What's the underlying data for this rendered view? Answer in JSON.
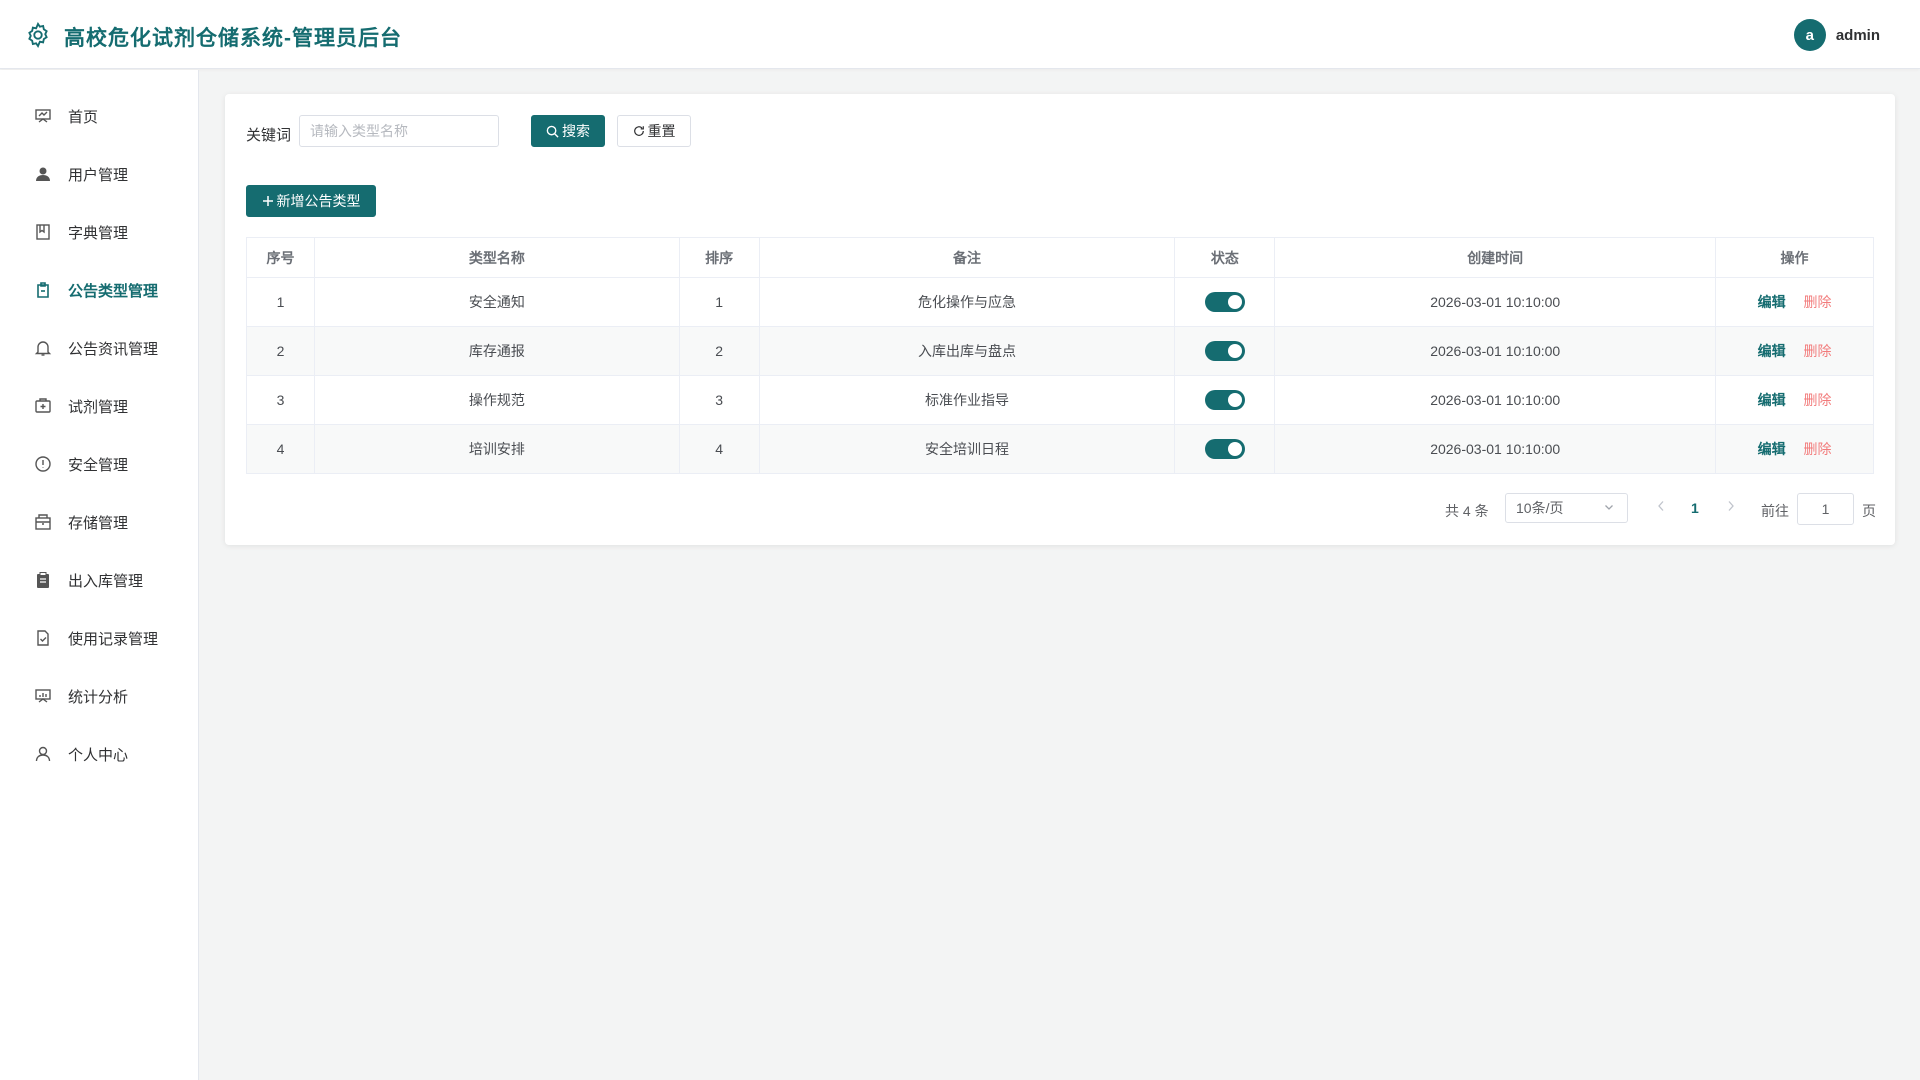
{
  "header": {
    "title": "高校危化试剂仓储系统-管理员后台",
    "avatar_letter": "a",
    "username": "admin"
  },
  "sidebar": {
    "items": [
      {
        "label": "首页",
        "icon": "dashboard-icon"
      },
      {
        "label": "用户管理",
        "icon": "user-icon"
      },
      {
        "label": "字典管理",
        "icon": "dictionary-icon"
      },
      {
        "label": "公告类型管理",
        "icon": "notice-type-icon",
        "active": true
      },
      {
        "label": "公告资讯管理",
        "icon": "bell-icon"
      },
      {
        "label": "试剂管理",
        "icon": "reagent-box-icon"
      },
      {
        "label": "安全管理",
        "icon": "warning-circle-icon"
      },
      {
        "label": "存储管理",
        "icon": "storage-icon"
      },
      {
        "label": "出入库管理",
        "icon": "clipboard-icon"
      },
      {
        "label": "使用记录管理",
        "icon": "document-check-icon"
      },
      {
        "label": "统计分析",
        "icon": "chart-board-icon"
      },
      {
        "label": "个人中心",
        "icon": "profile-icon"
      }
    ]
  },
  "filter": {
    "keyword_label": "关键词",
    "keyword_placeholder": "请输入类型名称",
    "keyword_value": "",
    "search_label": "搜索",
    "reset_label": "重置"
  },
  "toolbar": {
    "add_label": "新增公告类型"
  },
  "table": {
    "columns": [
      "序号",
      "类型名称",
      "排序",
      "备注",
      "状态",
      "创建时间",
      "操作"
    ],
    "edit_label": "编辑",
    "delete_label": "删除",
    "rows": [
      {
        "index": "1",
        "name": "安全通知",
        "sort": "1",
        "remark": "危化操作与应急",
        "status": true,
        "created": "2026-03-01 10:10:00"
      },
      {
        "index": "2",
        "name": "库存通报",
        "sort": "2",
        "remark": "入库出库与盘点",
        "status": true,
        "created": "2026-03-01 10:10:00"
      },
      {
        "index": "3",
        "name": "操作规范",
        "sort": "3",
        "remark": "标准作业指导",
        "status": true,
        "created": "2026-03-01 10:10:00"
      },
      {
        "index": "4",
        "name": "培训安排",
        "sort": "4",
        "remark": "安全培训日程",
        "status": true,
        "created": "2026-03-01 10:10:00"
      }
    ]
  },
  "pagination": {
    "total_text": "共 4 条",
    "page_size": "10条/页",
    "current_page": "1",
    "goto_label": "前往",
    "goto_value": "1",
    "page_suffix": "页"
  },
  "colors": {
    "primary": "#156c70",
    "danger": "#f27b7b"
  }
}
